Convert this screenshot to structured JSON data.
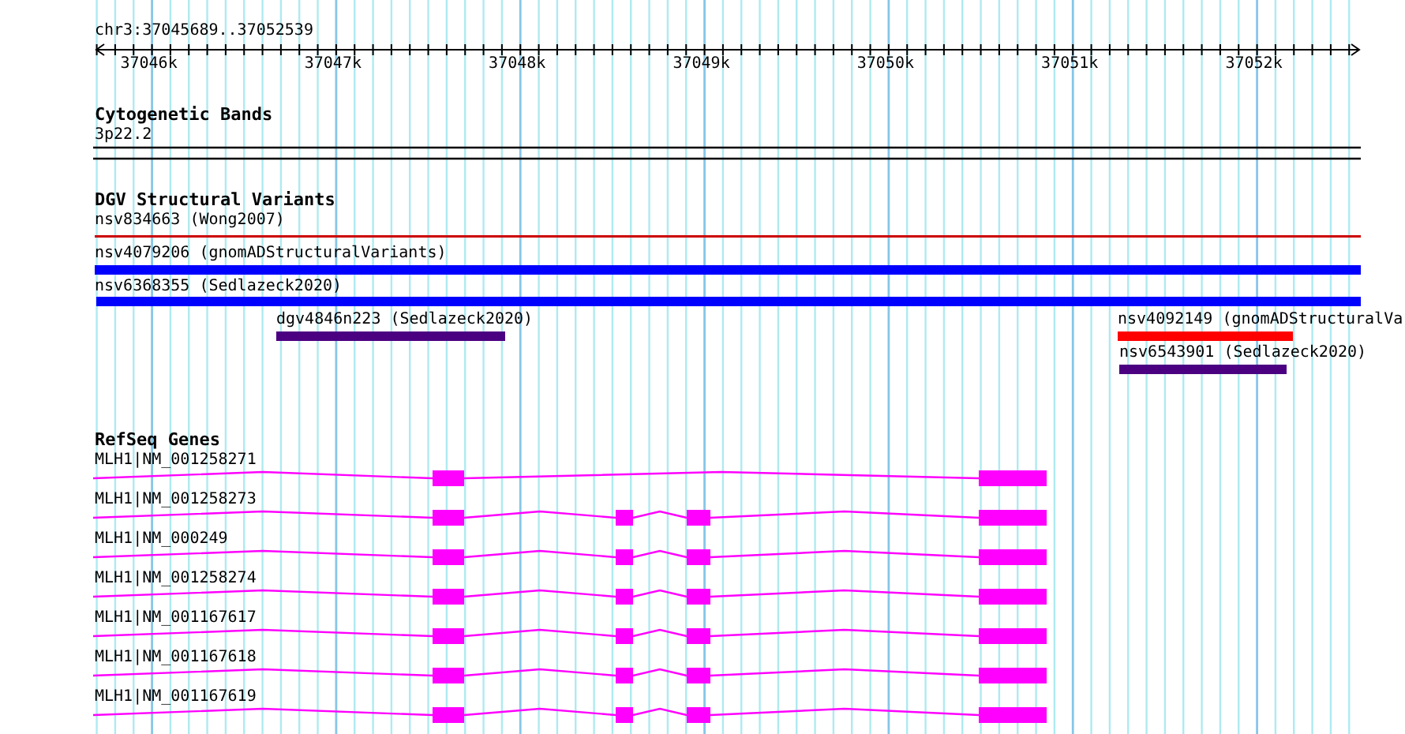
{
  "ruler": {
    "location": "chr3:37045689..37052539",
    "ticks": [
      "37046k",
      "37047k",
      "37048k",
      "37049k",
      "37050k",
      "37051k",
      "37052k"
    ]
  },
  "cytogenetic_bands": {
    "title": "Cytogenetic Bands",
    "band": "3p22.2"
  },
  "dgv": {
    "title": "DGV Structural Variants",
    "features": [
      {
        "label": "nsv834663 (Wong2007)",
        "kind": "line",
        "color": "#cc0000"
      },
      {
        "label": "nsv4079206 (gnomADStructuralVariants)",
        "kind": "bar",
        "color": "#0000ff"
      },
      {
        "label": "nsv6368355 (Sedlazeck2020)",
        "kind": "bar",
        "color": "#0000ff"
      },
      {
        "label": "dgv4846n223 (Sedlazeck2020)",
        "kind": "bar",
        "color": "#4b0082"
      },
      {
        "label": "nsv4092149 (gnomADStructuralVa",
        "kind": "bar",
        "color": "#ff0000"
      },
      {
        "label": "nsv6543901 (Sedlazeck2020)",
        "kind": "bar",
        "color": "#4b0082"
      }
    ]
  },
  "refseq": {
    "title": "RefSeq Genes",
    "transcripts": [
      {
        "label": "MLH1|NM_001258271"
      },
      {
        "label": "MLH1|NM_001258273"
      },
      {
        "label": "MLH1|NM_000249"
      },
      {
        "label": "MLH1|NM_001258274"
      },
      {
        "label": "MLH1|NM_001167617"
      },
      {
        "label": "MLH1|NM_001167618"
      },
      {
        "label": "MLH1|NM_001167619"
      }
    ]
  }
}
